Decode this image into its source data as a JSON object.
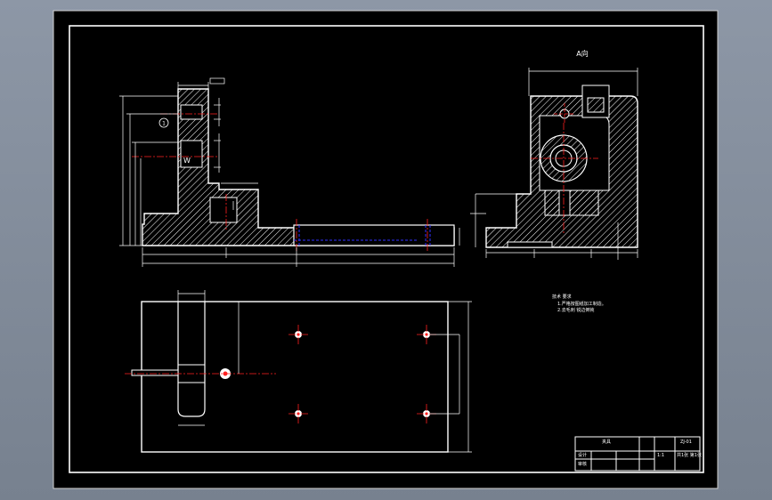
{
  "drawing": {
    "side_view_label": "A向",
    "section_mark": "1",
    "section_letter": "W",
    "notes": {
      "heading": "技术 要求",
      "line1": "1.严格按图纸加工制造。",
      "line2": "2.去毛刺 锐边倒钝"
    },
    "title_block": {
      "name": "夹具",
      "code": "ZJ-01",
      "designer": "设计",
      "checker": "审核",
      "scale": "1:1",
      "sheet": "共1张 第1张"
    }
  },
  "colors": {
    "background": "#000000",
    "frame": "#ffffff",
    "hatch": "#ffffff",
    "center_line": "#ff2020",
    "dimension_line": "#ffffff",
    "hidden_line": "#3030ff"
  }
}
